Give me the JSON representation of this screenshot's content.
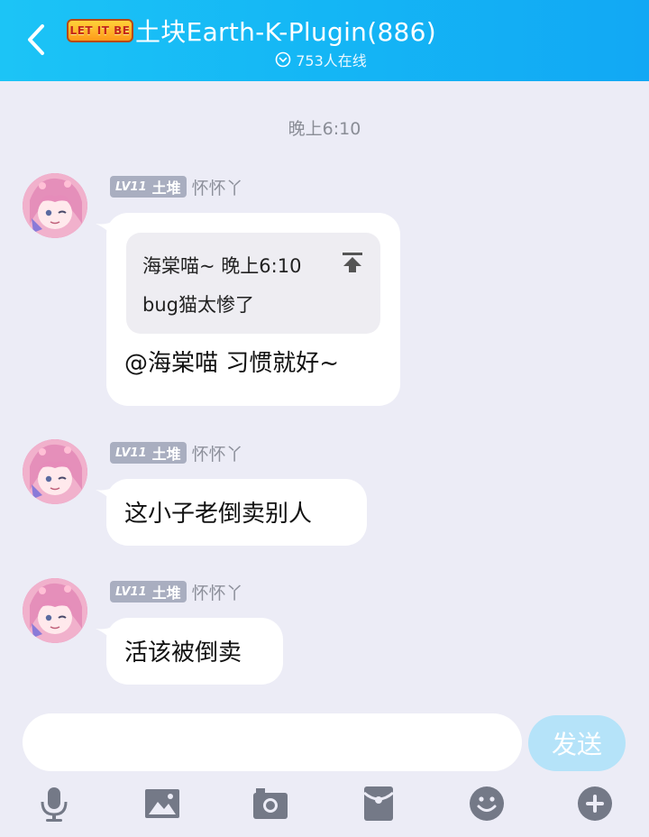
{
  "header": {
    "logo_text": "LET IT BE",
    "title": "土块Earth-K-Plugin(886)",
    "online": "753人在线"
  },
  "time_separator": "晚上6:10",
  "messages": [
    {
      "level": "LV11",
      "rank": "土堆",
      "nickname": "怀怀丫",
      "quote": {
        "head": "海棠喵~ 晚上6:10",
        "body": "bug猫太惨了"
      },
      "text": "@海棠喵 习惯就好~"
    },
    {
      "level": "LV11",
      "rank": "土堆",
      "nickname": "怀怀丫",
      "text": "这小子老倒卖别人"
    },
    {
      "level": "LV11",
      "rank": "土堆",
      "nickname": "怀怀丫",
      "text": "活该被倒卖"
    }
  ],
  "input": {
    "placeholder": "",
    "send_label": "发送"
  },
  "toolbar": {
    "icons": [
      "microphone-icon",
      "image-icon",
      "camera-icon",
      "red-packet-icon",
      "emoji-icon",
      "plus-icon"
    ]
  },
  "colors": {
    "header": "#14b6f5",
    "background": "#ececf6",
    "send_disabled": "#b5e3f9",
    "badge": "#a9aec0"
  }
}
